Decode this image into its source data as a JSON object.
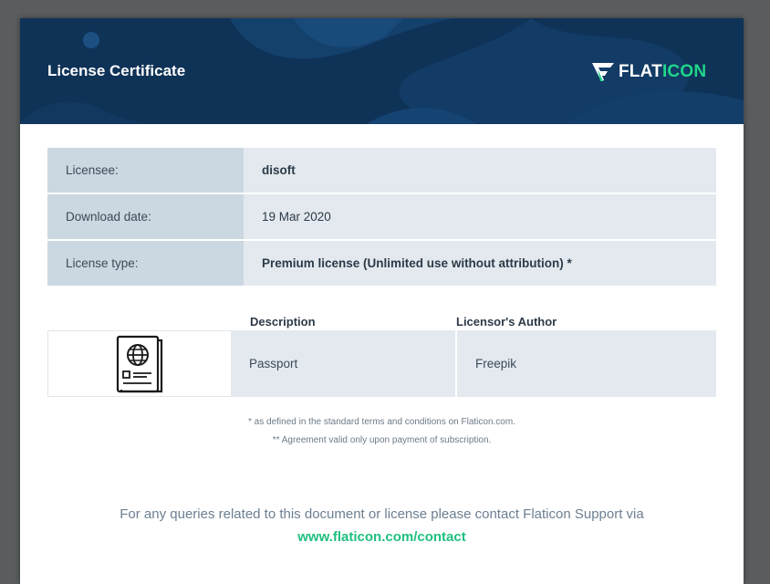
{
  "header": {
    "title": "License Certificate",
    "logo": {
      "word_a": "FLAT",
      "word_b": "ICON"
    }
  },
  "info": [
    {
      "label": "Licensee:",
      "value": "disoft"
    },
    {
      "label": "Download date:",
      "value": "19 Mar 2020"
    },
    {
      "label": "License type:",
      "value": "Premium license (Unlimited use without attribution) *"
    }
  ],
  "icons_table": {
    "col_description": "Description",
    "col_author": "Licensor's Author",
    "rows": [
      {
        "icon": "passport-icon",
        "description": "Passport",
        "author": "Freepik"
      }
    ]
  },
  "notes": {
    "note1": "* as defined in the standard terms and conditions on Flaticon.com.",
    "note2": "** Agreement valid only upon payment of subscription."
  },
  "contact": {
    "text": "For any queries related to this document or license please contact Flaticon Support via",
    "link": "www.flaticon.com/contact"
  },
  "colors": {
    "header_bg": "#0f3257",
    "accent_green": "#1fd68a",
    "label_bg": "#ccd8e1",
    "value_bg": "#e3e9ee"
  }
}
